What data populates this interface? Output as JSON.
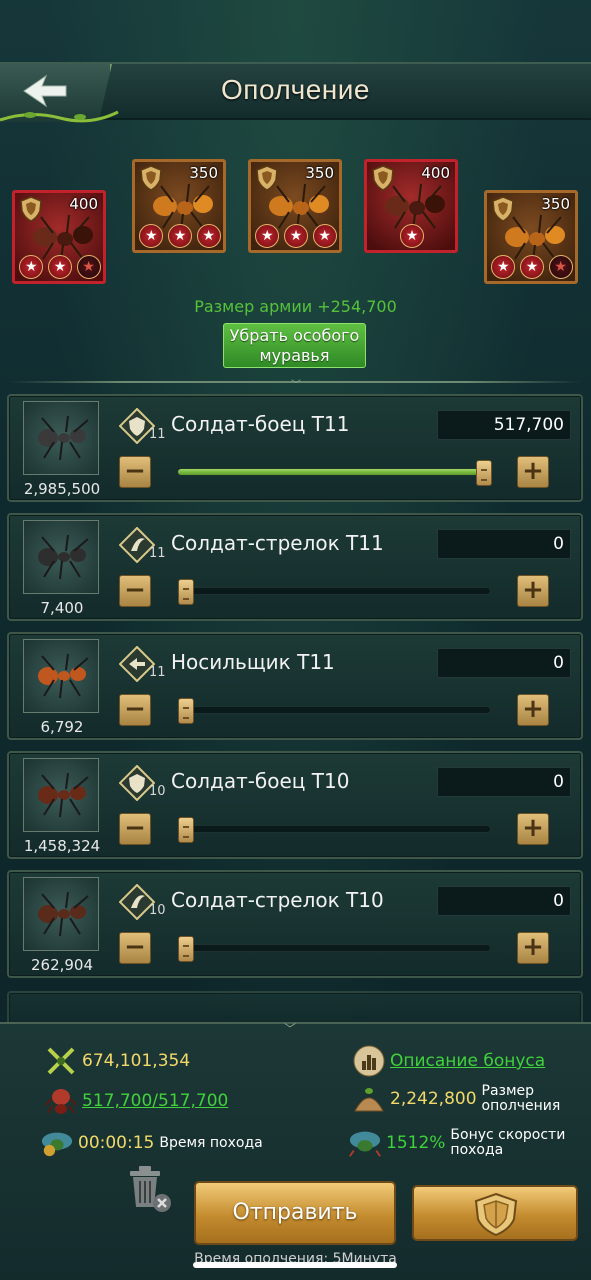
{
  "header": {
    "title": "Ополчение"
  },
  "heroes": [
    {
      "level": "400",
      "frame": "red",
      "stars": [
        "full",
        "full",
        "half"
      ]
    },
    {
      "level": "350",
      "frame": "orange",
      "stars": [
        "full",
        "full",
        "full"
      ]
    },
    {
      "level": "350",
      "frame": "orange",
      "stars": [
        "full",
        "full",
        "full"
      ]
    },
    {
      "level": "400",
      "frame": "red",
      "stars": [
        "full"
      ]
    },
    {
      "level": "350",
      "frame": "orange",
      "stars": [
        "full",
        "full",
        "half"
      ]
    }
  ],
  "army": {
    "size_text": "Размер армии +254,700",
    "remove_button_line1": "Убрать особого",
    "remove_button_line2": "муравья"
  },
  "troops": [
    {
      "name": "Солдат-боец T11",
      "tier": "11",
      "available": "2,985,500",
      "value": "517,700",
      "fill": 1.0,
      "type_icon": "fighter-icon"
    },
    {
      "name": "Солдат-стрелок T11",
      "tier": "11",
      "available": "7,400",
      "value": "0",
      "fill": 0.0,
      "type_icon": "shooter-icon"
    },
    {
      "name": "Носильщик T11",
      "tier": "11",
      "available": "6,792",
      "value": "0",
      "fill": 0.0,
      "type_icon": "carrier-icon"
    },
    {
      "name": "Солдат-боец T10",
      "tier": "10",
      "available": "1,458,324",
      "value": "0",
      "fill": 0.0,
      "type_icon": "fighter-icon"
    },
    {
      "name": "Солдат-стрелок T10",
      "tier": "10",
      "available": "262,904",
      "value": "0",
      "fill": 0.0,
      "type_icon": "shooter-icon"
    }
  ],
  "stats": {
    "power": "674,101,354",
    "bonus_link": "Описание бонуса",
    "troops_count": "517,700/517,700",
    "rally_size_value": "2,242,800",
    "rally_size_label_line1": "Размер",
    "rally_size_label_line2": "ополчения",
    "march_time_value": "00:00:15",
    "march_time_label": "Время похода",
    "speed_bonus_value": "1512%",
    "speed_bonus_label_line1": "Бонус скорости",
    "speed_bonus_label_line2": "похода"
  },
  "actions": {
    "send_label": "Отправить",
    "rally_time_note": "Время ополчения: 5Минута"
  },
  "colors": {
    "accent_green": "#3fd23a",
    "gold": "#f2d96a",
    "button_gold": "#c48c2f"
  }
}
